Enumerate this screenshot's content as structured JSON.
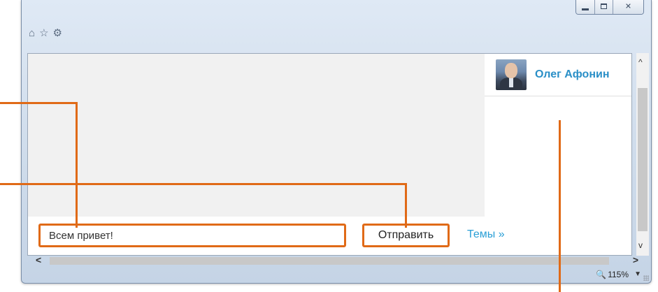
{
  "window": {
    "minimize_glyph": "—",
    "maximize_glyph": "□",
    "close_glyph": "✕"
  },
  "toolbar": {
    "home_icon": "⌂",
    "favorites_icon": "☆",
    "settings_icon": "⚙"
  },
  "user_panel": {
    "name": "Олег Афонин"
  },
  "chat": {
    "message_value": "Всем привет!",
    "send_label": "Отправить",
    "themes_link": "Темы »"
  },
  "scrollbars": {
    "up_glyph": "^",
    "down_glyph": "v",
    "left_glyph": "<",
    "right_glyph": ">"
  },
  "status": {
    "zoom": "115%",
    "zoom_icon": "🔍"
  },
  "colors": {
    "accent_callout": "#e06a17",
    "link": "#2a9fd6",
    "user_name": "#2a8fc7"
  }
}
